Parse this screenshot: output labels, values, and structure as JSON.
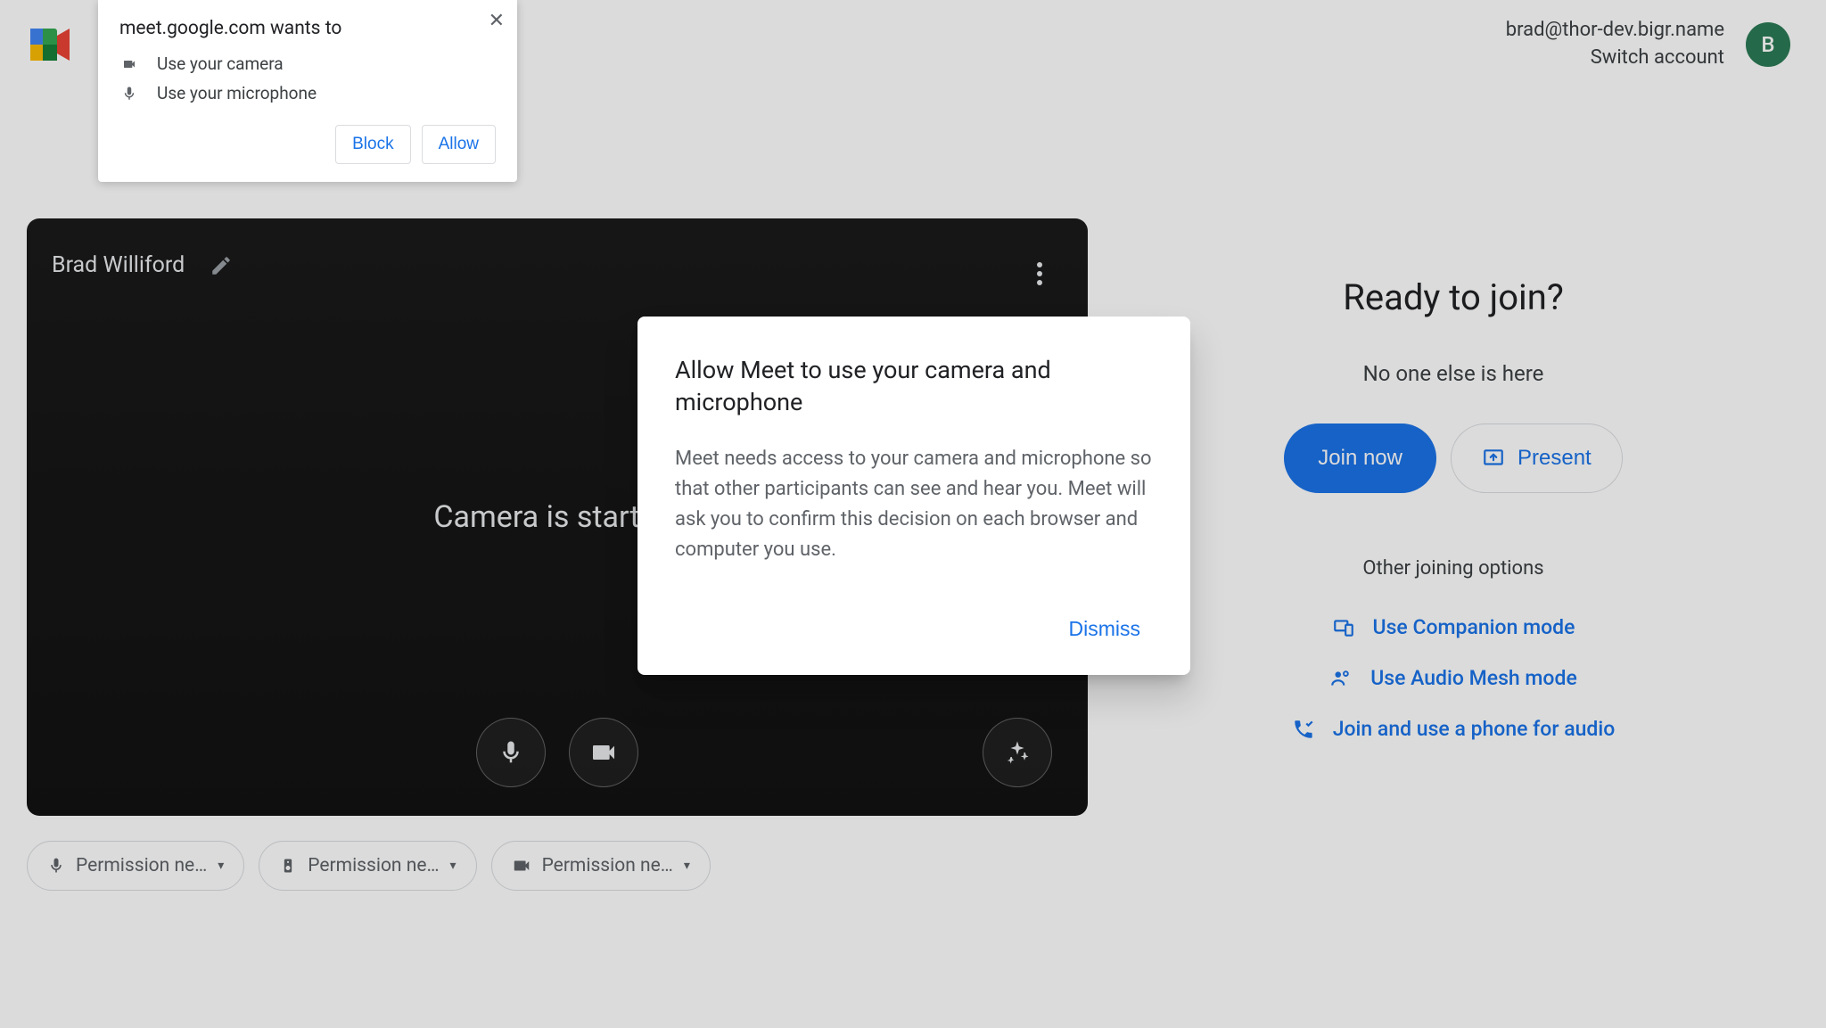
{
  "header": {
    "account_email": "brad@thor-dev.bigr.name",
    "switch_label": "Switch account",
    "avatar_initial": "B"
  },
  "preview": {
    "user_name": "Brad Williford",
    "status_text": "Camera is starting"
  },
  "pills": {
    "mic": "Permission ne…",
    "speaker": "Permission ne…",
    "cam": "Permission ne…"
  },
  "join": {
    "ready": "Ready to join?",
    "no_one": "No one else is here",
    "join_now": "Join now",
    "present": "Present",
    "other_label": "Other joining options",
    "companion": "Use Companion mode",
    "audio_mesh": "Use Audio Mesh mode",
    "phone": "Join and use a phone for audio"
  },
  "browser_prompt": {
    "host": "meet.google.com wants to",
    "camera": "Use your camera",
    "mic": "Use your microphone",
    "block": "Block",
    "allow": "Allow"
  },
  "meet_dialog": {
    "heading": "Allow Meet to use your camera and microphone",
    "body": "Meet needs access to your camera and microphone so that other participants can see and hear you. Meet will ask you to confirm this decision on each browser and computer you use.",
    "dismiss": "Dismiss"
  }
}
